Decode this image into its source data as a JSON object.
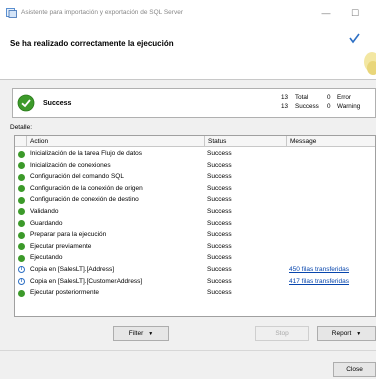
{
  "window": {
    "title": "Asistente para importación y exportación de SQL Server",
    "icon": "sql-wizard-icon"
  },
  "header": {
    "title": "Se ha realizado correctamente la ejecución"
  },
  "summary": {
    "status": "Success",
    "total_count": "13",
    "total_label": "Total",
    "error_count": "0",
    "error_label": "Error",
    "success_count": "13",
    "success_label": "Success",
    "warning_count": "0",
    "warning_label": "Warning"
  },
  "details": {
    "label": "Detalle:",
    "columns": {
      "action": "Action",
      "status": "Status",
      "message": "Message"
    },
    "rows": [
      {
        "icon": "ok",
        "action": "Inicialización de la tarea Flujo de datos",
        "status": "Success",
        "message": ""
      },
      {
        "icon": "ok",
        "action": "Inicialización de conexiones",
        "status": "Success",
        "message": ""
      },
      {
        "icon": "ok",
        "action": "Configuración del comando SQL",
        "status": "Success",
        "message": ""
      },
      {
        "icon": "ok",
        "action": "Configuración de la conexión de origen",
        "status": "Success",
        "message": ""
      },
      {
        "icon": "ok",
        "action": "Configuración de conexión de destino",
        "status": "Success",
        "message": ""
      },
      {
        "icon": "ok",
        "action": "Validando",
        "status": "Success",
        "message": ""
      },
      {
        "icon": "ok",
        "action": "Guardando",
        "status": "Success",
        "message": ""
      },
      {
        "icon": "ok",
        "action": "Preparar para la ejecución",
        "status": "Success",
        "message": ""
      },
      {
        "icon": "ok",
        "action": "Ejecutar previamente",
        "status": "Success",
        "message": ""
      },
      {
        "icon": "ok",
        "action": "Ejecutando",
        "status": "Success",
        "message": ""
      },
      {
        "icon": "info",
        "action": "Copia en [SalesLT].[Address]",
        "status": "Success",
        "message": "450 filas transferidas"
      },
      {
        "icon": "info",
        "action": "Copia en [SalesLT].[CustomerAddress]",
        "status": "Success",
        "message": "417 filas transferidas"
      },
      {
        "icon": "ok",
        "action": "Ejecutar posteriormente",
        "status": "Success",
        "message": ""
      }
    ]
  },
  "buttons": {
    "filter": "Filter",
    "stop": "Stop",
    "report": "Report",
    "close": "Close"
  },
  "colors": {
    "success": "#3c9a2a",
    "info": "#2d6fc4",
    "link": "#0645ad"
  }
}
